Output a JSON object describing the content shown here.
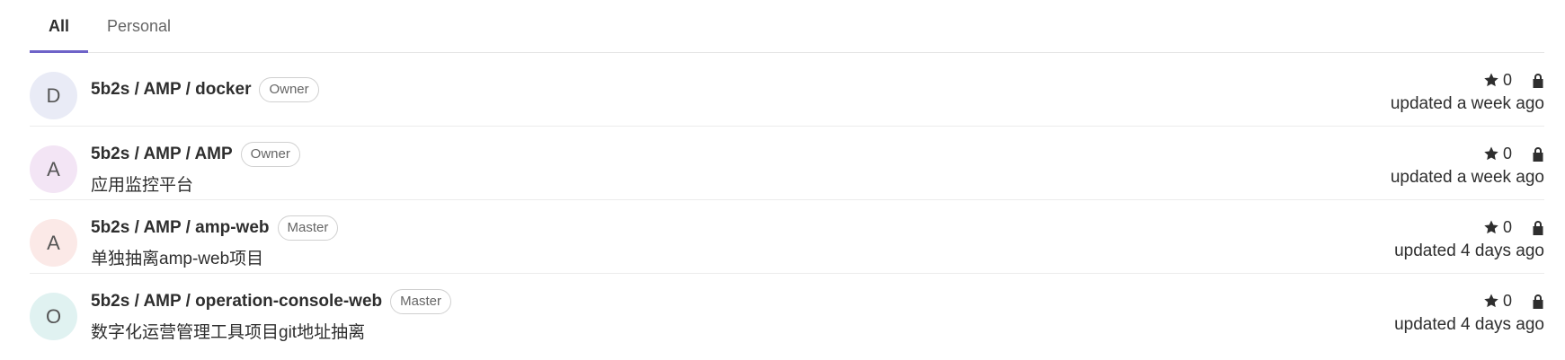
{
  "tabs": [
    {
      "label": "All",
      "active": true
    },
    {
      "label": "Personal",
      "active": false
    }
  ],
  "projects": [
    {
      "avatar_letter": "D",
      "avatar_color": "#e9ebf6",
      "name": "5b2s / AMP / docker",
      "role": "Owner",
      "description": "",
      "stars": "0",
      "updated": "updated a week ago"
    },
    {
      "avatar_letter": "A",
      "avatar_color": "#f3e5f5",
      "name": "5b2s / AMP / AMP",
      "role": "Owner",
      "description": "应用监控平台",
      "stars": "0",
      "updated": "updated a week ago"
    },
    {
      "avatar_letter": "A",
      "avatar_color": "#fbe9e7",
      "name": "5b2s / AMP / amp-web",
      "role": "Master",
      "description": "单独抽离amp-web项目",
      "stars": "0",
      "updated": "updated 4 days ago"
    },
    {
      "avatar_letter": "O",
      "avatar_color": "#e0f2f1",
      "name": "5b2s / AMP / operation-console-web",
      "role": "Master",
      "description": "数字化运营管理工具项目git地址抽离",
      "stars": "0",
      "updated": "updated 4 days ago"
    }
  ],
  "icons": {
    "star": "star-icon",
    "lock": "lock-icon"
  }
}
